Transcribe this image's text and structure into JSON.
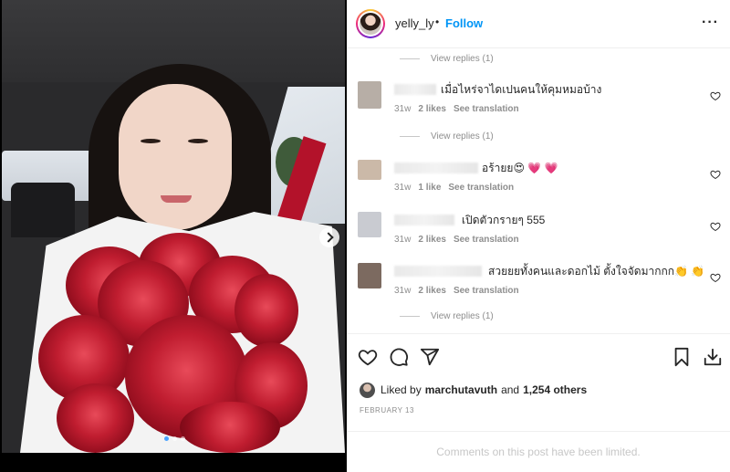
{
  "post": {
    "username": "yelly_ly",
    "separator": "•",
    "follow_label": "Follow",
    "more_label": "···",
    "photo_count": 3,
    "active_photo": 1
  },
  "comments": {
    "view_replies_label": "View replies (1)",
    "items": [
      {
        "text": "เมื่อไหร่จาไดเปนคนให้คุมหมอบ้าง",
        "age": "31w",
        "likes": "2 likes",
        "translate": "See translation",
        "avatar_color": "#b7aea6"
      },
      {
        "text": "อร้ายย😍 💗 💗",
        "age": "31w",
        "likes": "1 like",
        "translate": "See translation",
        "avatar_color": "#cbb9a8"
      },
      {
        "text": "เปิดตัวกรายๆ 555",
        "age": "31w",
        "likes": "2 likes",
        "translate": "See translation",
        "avatar_color": "#c9cbd1"
      },
      {
        "text": "สวยยยทั้งคนและดอกไม้ ตั้งใจจัดมากกก👏 👏",
        "age": "31w",
        "likes": "2 likes",
        "translate": "See translation",
        "avatar_color": "#7c6a60"
      }
    ]
  },
  "likes": {
    "prefix": "Liked by",
    "user": "marchutavuth",
    "conjunction": "and",
    "count": "1,254 others"
  },
  "date": "FEBRUARY 13",
  "limited_notice": "Comments on this post have been limited."
}
